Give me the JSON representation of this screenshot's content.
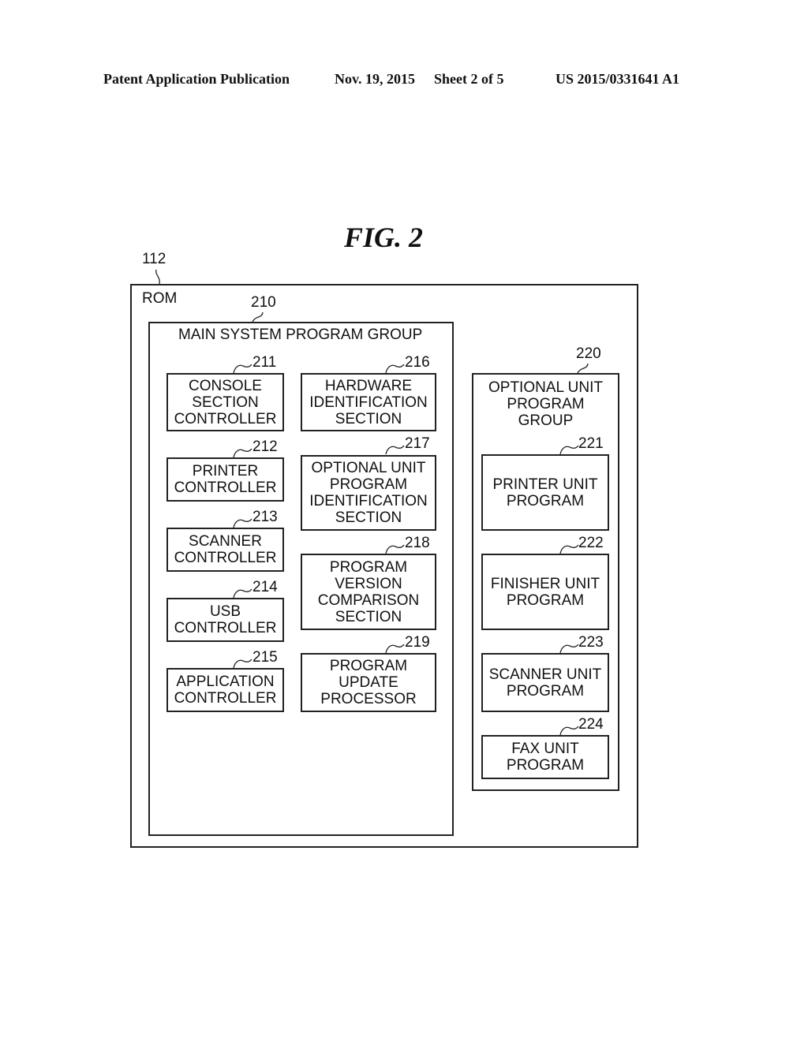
{
  "header": {
    "publication": "Patent Application Publication",
    "date": "Nov. 19, 2015",
    "sheet": "Sheet 2 of 5",
    "number": "US 2015/0331641 A1"
  },
  "figure": {
    "title": "FIG. 2"
  },
  "rom": {
    "ref": "112",
    "label": "ROM"
  },
  "main_group": {
    "ref": "210",
    "label": "MAIN SYSTEM PROGRAM GROUP",
    "left_column": [
      {
        "ref": "211",
        "label": "CONSOLE\nSECTION\nCONTROLLER"
      },
      {
        "ref": "212",
        "label": "PRINTER\nCONTROLLER"
      },
      {
        "ref": "213",
        "label": "SCANNER\nCONTROLLER"
      },
      {
        "ref": "214",
        "label": "USB\nCONTROLLER"
      },
      {
        "ref": "215",
        "label": "APPLICATION\nCONTROLLER"
      }
    ],
    "right_column": [
      {
        "ref": "216",
        "label": "HARDWARE\nIDENTIFICATION\nSECTION"
      },
      {
        "ref": "217",
        "label": "OPTIONAL UNIT\nPROGRAM\nIDENTIFICATION\nSECTION"
      },
      {
        "ref": "218",
        "label": "PROGRAM\nVERSION\nCOMPARISON\nSECTION"
      },
      {
        "ref": "219",
        "label": "PROGRAM\nUPDATE\nPROCESSOR"
      }
    ]
  },
  "optional_group": {
    "ref": "220",
    "label": "OPTIONAL UNIT\nPROGRAM\nGROUP",
    "items": [
      {
        "ref": "221",
        "label": "PRINTER UNIT\nPROGRAM"
      },
      {
        "ref": "222",
        "label": "FINISHER UNIT\nPROGRAM"
      },
      {
        "ref": "223",
        "label": "SCANNER UNIT\nPROGRAM"
      },
      {
        "ref": "224",
        "label": "FAX UNIT\nPROGRAM"
      }
    ]
  }
}
